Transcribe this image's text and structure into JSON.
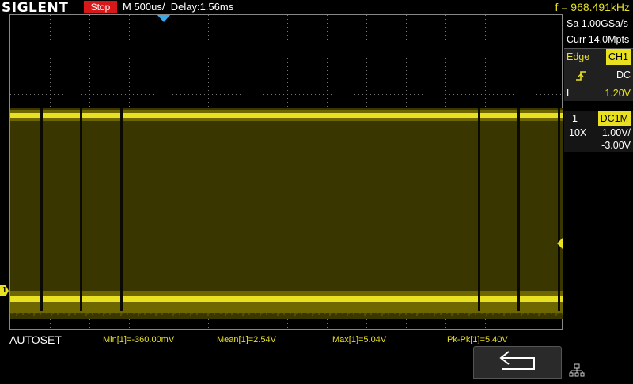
{
  "brand": "SIGLENT",
  "status": "Stop",
  "timebase": "M 500us/",
  "delay": "Delay:1.56ms",
  "frequency": "f = 968.491kHz",
  "acquisition": {
    "sample_rate": "Sa 1.00GSa/s",
    "memory": "Curr 14.0Mpts"
  },
  "trigger": {
    "type": "Edge",
    "source": "CH1",
    "coupling": "DC",
    "level_label": "L",
    "level": "1.20V"
  },
  "channel1": {
    "number": "1",
    "coupling": "DC1M",
    "probe": "10X",
    "scale": "1.00V/",
    "offset": "-3.00V"
  },
  "bottom": {
    "autoset": "AUTOSET",
    "measurements": {
      "min": "Min[1]=-360.00mV",
      "mean": "Mean[1]=2.54V",
      "max": "Max[1]=5.04V",
      "pkpk": "Pk-Pk[1]=5.40V"
    }
  },
  "colors": {
    "trace": "#e8e020",
    "stop": "#d81818",
    "trigger_marker": "#3aa9e8"
  }
}
